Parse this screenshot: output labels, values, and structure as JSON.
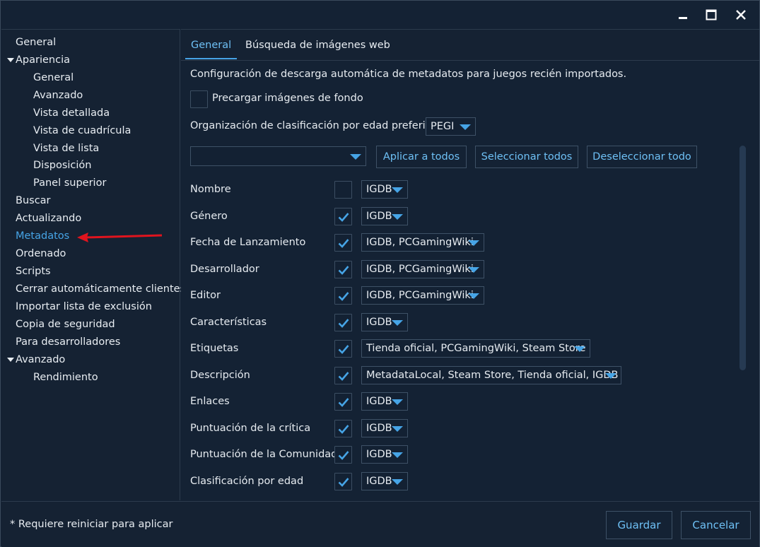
{
  "sidebar": {
    "items": [
      {
        "label": "General",
        "level": 0
      },
      {
        "label": "Apariencia",
        "level": 0,
        "expanded": true
      },
      {
        "label": "General",
        "level": 1
      },
      {
        "label": "Avanzado",
        "level": 1
      },
      {
        "label": "Vista detallada",
        "level": 1
      },
      {
        "label": "Vista de cuadrícula",
        "level": 1
      },
      {
        "label": "Vista de lista",
        "level": 1
      },
      {
        "label": "Disposición",
        "level": 1
      },
      {
        "label": "Panel superior",
        "level": 1
      },
      {
        "label": "Buscar",
        "level": 0
      },
      {
        "label": "Actualizando",
        "level": 0
      },
      {
        "label": "Metadatos",
        "level": 0,
        "active": true
      },
      {
        "label": "Ordenado",
        "level": 0
      },
      {
        "label": "Scripts",
        "level": 0
      },
      {
        "label": "Cerrar automáticamente clientes",
        "level": 0
      },
      {
        "label": "Importar lista de exclusión",
        "level": 0
      },
      {
        "label": "Copia de seguridad",
        "level": 0
      },
      {
        "label": "Para desarrolladores",
        "level": 0
      },
      {
        "label": "Avanzado",
        "level": 0,
        "expanded": true
      },
      {
        "label": "Rendimiento",
        "level": 1
      }
    ]
  },
  "tabs": [
    {
      "label": "General",
      "active": true
    },
    {
      "label": "Búsqueda de imágenes web",
      "active": false
    }
  ],
  "main": {
    "description": "Configuración de descarga automática de metadatos para juegos recién importados.",
    "preload_label": "Precargar imágenes de fondo",
    "preload_checked": false,
    "rating_org_label": "Organización de clasificación por edad preferida",
    "rating_org_value": "PEGI",
    "bulk_dropdown_value": "",
    "apply_all_label": "Aplicar a todos",
    "select_all_label": "Seleccionar todos",
    "deselect_all_label": "Deseleccionar todo",
    "fields": [
      {
        "label": "Nombre",
        "checked": false,
        "source": "IGDB"
      },
      {
        "label": "Género",
        "checked": true,
        "source": "IGDB"
      },
      {
        "label": "Fecha de Lanzamiento",
        "checked": true,
        "source": "IGDB, PCGamingWiki"
      },
      {
        "label": "Desarrollador",
        "checked": true,
        "source": "IGDB, PCGamingWiki"
      },
      {
        "label": "Editor",
        "checked": true,
        "source": "IGDB, PCGamingWiki"
      },
      {
        "label": "Características",
        "checked": true,
        "source": "IGDB"
      },
      {
        "label": "Etiquetas",
        "checked": true,
        "source": "Tienda oficial, PCGamingWiki, Steam Store"
      },
      {
        "label": "Descripción",
        "checked": true,
        "source": "MetadataLocal, Steam Store, Tienda oficial, IGDB"
      },
      {
        "label": "Enlaces",
        "checked": true,
        "source": "IGDB"
      },
      {
        "label": "Puntuación de la crítica",
        "checked": true,
        "source": "IGDB"
      },
      {
        "label": "Puntuación de la Comunidad",
        "checked": true,
        "source": "IGDB"
      },
      {
        "label": "Clasificación por edad",
        "checked": true,
        "source": "IGDB"
      }
    ]
  },
  "footer": {
    "note": "* Requiere reiniciar para aplicar",
    "save_label": "Guardar",
    "cancel_label": "Cancelar"
  },
  "icons": {
    "minimize": "minimize-icon",
    "maximize": "maximize-icon",
    "close": "close-icon",
    "check": "checkmark-icon",
    "caret": "caret-down-icon",
    "annotation": "red-arrow"
  },
  "colors": {
    "background": "#142234",
    "accent": "#46a4e6",
    "annotation_arrow": "#e0141e"
  }
}
